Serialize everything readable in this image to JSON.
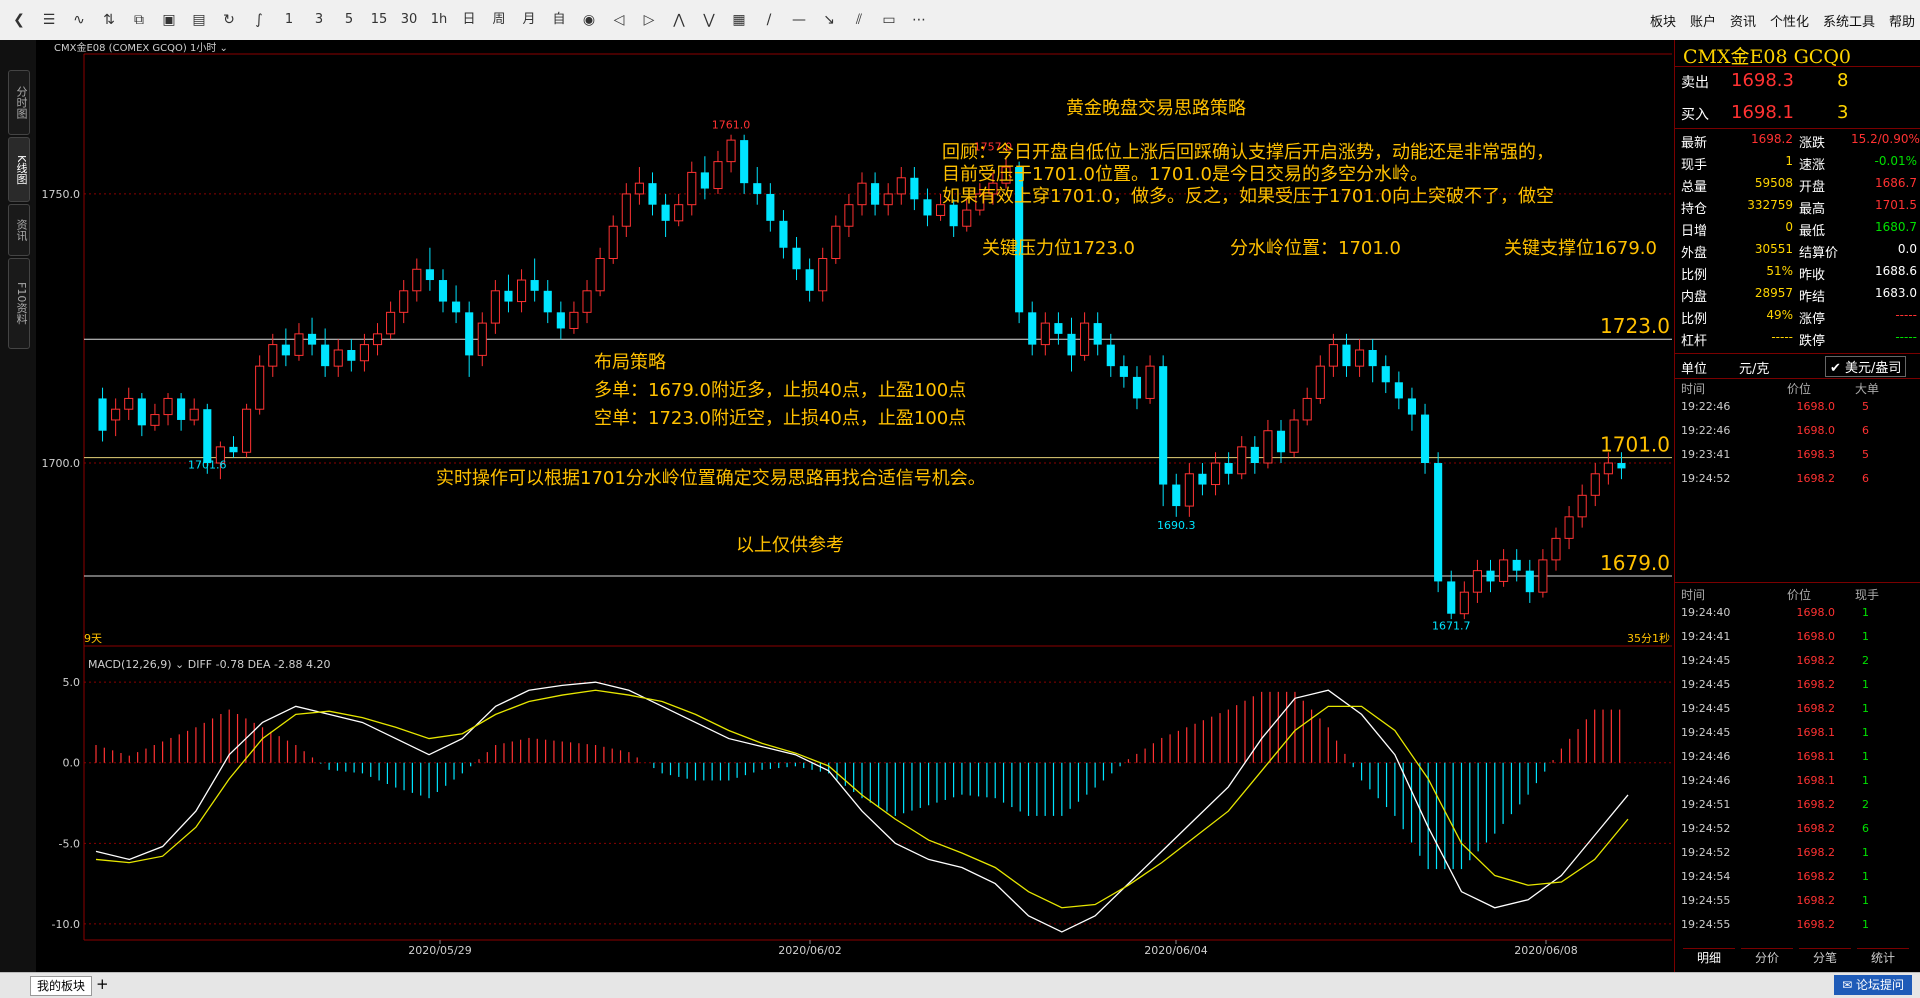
{
  "toolbar": {
    "tools": [
      {
        "icon": "back-icon",
        "g": "❮"
      },
      {
        "icon": "list-icon",
        "g": "☰"
      },
      {
        "icon": "line-icon",
        "g": "∿"
      },
      {
        "icon": "compare-icon",
        "g": "⇅"
      },
      {
        "icon": "stack-icon",
        "g": "⧉"
      },
      {
        "icon": "panel-icon",
        "g": "▣"
      },
      {
        "icon": "save-icon",
        "g": "▤"
      },
      {
        "icon": "refresh-icon",
        "g": "↻"
      },
      {
        "icon": "indicator-icon",
        "g": "∫"
      }
    ],
    "periods": [
      "1",
      "3",
      "5",
      "15",
      "30",
      "1h",
      "日",
      "周",
      "月",
      "自"
    ],
    "tools2": [
      {
        "icon": "eye-icon",
        "g": "◉"
      },
      {
        "icon": "left-icon",
        "g": "◁"
      },
      {
        "icon": "right-icon",
        "g": "▷"
      },
      {
        "icon": "zoom-in-icon",
        "g": "⋀"
      },
      {
        "icon": "zoom-out-icon",
        "g": "⋁"
      },
      {
        "icon": "layout-icon",
        "g": "▦"
      },
      {
        "icon": "trendline-icon",
        "g": "/"
      },
      {
        "icon": "hline-icon",
        "g": "—"
      },
      {
        "icon": "arrow-icon",
        "g": "↘"
      },
      {
        "icon": "parallel-icon",
        "g": "⫽"
      },
      {
        "icon": "rect-icon",
        "g": "▭"
      },
      {
        "icon": "more-icon",
        "g": "⋯"
      }
    ],
    "menu": [
      "板块",
      "账户",
      "资讯",
      "个性化",
      "系统工具",
      "帮助"
    ]
  },
  "side_tabs": [
    "分时图",
    "K线图",
    "资讯",
    "F10资料"
  ],
  "chart_header": {
    "symbol": "CMX金E08 (COMEX GCQO)",
    "period": "1小时"
  },
  "price_axis": [
    "1750.0",
    "1700.0"
  ],
  "macd_axis": [
    "5.0",
    "0.0",
    "-5.0",
    "-10.0"
  ],
  "date_labels": [
    "2020/05/29",
    "2020/06/02",
    "2020/06/04",
    "2020/06/08"
  ],
  "corner_left": "9天",
  "corner_right": "35分1秒",
  "macd_header": {
    "name": "MACD(12,26,9)",
    "diff": "DIFF -0.78",
    "dea": "DEA -2.88",
    "val": "4.20"
  },
  "annotations": {
    "title": "黄金晚盘交易思路策略",
    "review": [
      "回顾：今日开盘自低位上涨后回踩确认支撑后开启涨势，动能还是非常强的，",
      "目前受压于1701.0位置。1701.0是今日交易的多空分水岭。",
      "如果有效上穿1701.0，做多。反之，如果受压于1701.0向上突破不了，做空"
    ],
    "key_resist": "关键压力位1723.0",
    "pivot": "分水岭位置：1701.0",
    "key_support": "关键支撑位1679.0",
    "strategy": [
      "布局策略",
      "多单：1679.0附近多，止损40点，止盈100点",
      "空单：1723.0附近空，止损40点，止盈100点"
    ],
    "realtime": "实时操作可以根据1701分水岭位置确定交易思路再找合适信号机会。",
    "disclaimer": "以上仅供参考"
  },
  "levels": [
    {
      "label": "1723.0",
      "value": 1723.0
    },
    {
      "label": "1701.0",
      "value": 1701.0
    },
    {
      "label": "1679.0",
      "value": 1679.0
    }
  ],
  "extremes": [
    "1761.0",
    "1757.0",
    "1701.6",
    "1690.3",
    "1671.7"
  ],
  "chart_data": {
    "type": "candlestick",
    "ylim": [
      1666,
      1776
    ],
    "candles": [
      [
        1712,
        1706,
        1714,
        1704
      ],
      [
        1708,
        1710,
        1712,
        1705
      ],
      [
        1710,
        1712,
        1714,
        1708
      ],
      [
        1712,
        1707,
        1713,
        1705
      ],
      [
        1707,
        1709,
        1711,
        1706
      ],
      [
        1709,
        1712,
        1713,
        1707
      ],
      [
        1712,
        1708,
        1713,
        1706
      ],
      [
        1708,
        1710,
        1712,
        1707
      ],
      [
        1710,
        1700,
        1711,
        1698
      ],
      [
        1700,
        1703,
        1704,
        1697
      ],
      [
        1703,
        1702,
        1705,
        1701
      ],
      [
        1702,
        1710,
        1711,
        1701
      ],
      [
        1710,
        1718,
        1720,
        1709
      ],
      [
        1718,
        1722,
        1724,
        1716
      ],
      [
        1722,
        1720,
        1725,
        1718
      ],
      [
        1720,
        1724,
        1726,
        1719
      ],
      [
        1724,
        1722,
        1727,
        1720
      ],
      [
        1722,
        1718,
        1725,
        1716
      ],
      [
        1718,
        1721,
        1723,
        1716
      ],
      [
        1721,
        1719,
        1723,
        1717
      ],
      [
        1719,
        1722,
        1724,
        1717
      ],
      [
        1722,
        1724,
        1726,
        1720
      ],
      [
        1724,
        1728,
        1730,
        1723
      ],
      [
        1728,
        1732,
        1734,
        1726
      ],
      [
        1732,
        1736,
        1738,
        1730
      ],
      [
        1736,
        1734,
        1740,
        1732
      ],
      [
        1734,
        1730,
        1736,
        1728
      ],
      [
        1730,
        1728,
        1733,
        1726
      ],
      [
        1728,
        1720,
        1730,
        1716
      ],
      [
        1720,
        1726,
        1728,
        1718
      ],
      [
        1726,
        1732,
        1734,
        1724
      ],
      [
        1732,
        1730,
        1735,
        1728
      ],
      [
        1730,
        1734,
        1736,
        1728
      ],
      [
        1734,
        1732,
        1738,
        1730
      ],
      [
        1732,
        1728,
        1734,
        1726
      ],
      [
        1728,
        1725,
        1730,
        1723
      ],
      [
        1725,
        1728,
        1730,
        1724
      ],
      [
        1728,
        1732,
        1734,
        1726
      ],
      [
        1732,
        1738,
        1740,
        1731
      ],
      [
        1738,
        1744,
        1746,
        1737
      ],
      [
        1744,
        1750,
        1752,
        1742
      ],
      [
        1750,
        1752,
        1755,
        1748
      ],
      [
        1752,
        1748,
        1754,
        1746
      ],
      [
        1748,
        1745,
        1750,
        1742
      ],
      [
        1745,
        1748,
        1750,
        1744
      ],
      [
        1748,
        1754,
        1756,
        1746
      ],
      [
        1754,
        1751,
        1757,
        1749
      ],
      [
        1751,
        1756,
        1758,
        1750
      ],
      [
        1756,
        1760,
        1761,
        1754
      ],
      [
        1760,
        1752,
        1761,
        1750
      ],
      [
        1752,
        1750,
        1755,
        1748
      ],
      [
        1750,
        1745,
        1752,
        1743
      ],
      [
        1745,
        1740,
        1747,
        1738
      ],
      [
        1740,
        1736,
        1742,
        1734
      ],
      [
        1736,
        1732,
        1738,
        1730
      ],
      [
        1732,
        1738,
        1740,
        1730
      ],
      [
        1738,
        1744,
        1746,
        1737
      ],
      [
        1744,
        1748,
        1750,
        1742
      ],
      [
        1748,
        1752,
        1754,
        1746
      ],
      [
        1752,
        1748,
        1754,
        1746
      ],
      [
        1748,
        1750,
        1752,
        1746
      ],
      [
        1750,
        1753,
        1755,
        1748
      ],
      [
        1753,
        1749,
        1755,
        1747
      ],
      [
        1749,
        1746,
        1751,
        1744
      ],
      [
        1746,
        1748,
        1750,
        1745
      ],
      [
        1748,
        1744,
        1749,
        1742
      ],
      [
        1744,
        1747,
        1749,
        1743
      ],
      [
        1747,
        1750,
        1752,
        1746
      ],
      [
        1750,
        1752,
        1754,
        1748
      ],
      [
        1752,
        1755,
        1757,
        1751
      ],
      [
        1755,
        1728,
        1756,
        1726
      ],
      [
        1728,
        1722,
        1730,
        1720
      ],
      [
        1722,
        1726,
        1728,
        1720
      ],
      [
        1726,
        1724,
        1728,
        1722
      ],
      [
        1724,
        1720,
        1727,
        1717
      ],
      [
        1720,
        1726,
        1728,
        1719
      ],
      [
        1726,
        1722,
        1728,
        1720
      ],
      [
        1722,
        1718,
        1724,
        1716
      ],
      [
        1718,
        1716,
        1720,
        1714
      ],
      [
        1716,
        1712,
        1718,
        1710
      ],
      [
        1712,
        1718,
        1720,
        1711
      ],
      [
        1718,
        1696,
        1720,
        1692
      ],
      [
        1696,
        1692,
        1698,
        1690
      ],
      [
        1692,
        1698,
        1700,
        1690
      ],
      [
        1698,
        1696,
        1700,
        1694
      ],
      [
        1696,
        1700,
        1702,
        1694
      ],
      [
        1700,
        1698,
        1702,
        1696
      ],
      [
        1698,
        1703,
        1705,
        1697
      ],
      [
        1703,
        1700,
        1705,
        1698
      ],
      [
        1700,
        1706,
        1708,
        1699
      ],
      [
        1706,
        1702,
        1708,
        1700
      ],
      [
        1702,
        1708,
        1710,
        1701
      ],
      [
        1708,
        1712,
        1714,
        1707
      ],
      [
        1712,
        1718,
        1720,
        1711
      ],
      [
        1718,
        1722,
        1724,
        1716
      ],
      [
        1722,
        1718,
        1724,
        1716
      ],
      [
        1718,
        1721,
        1723,
        1716
      ],
      [
        1721,
        1718,
        1723,
        1715
      ],
      [
        1718,
        1715,
        1720,
        1713
      ],
      [
        1715,
        1712,
        1717,
        1710
      ],
      [
        1712,
        1709,
        1714,
        1706
      ],
      [
        1709,
        1700,
        1711,
        1698
      ],
      [
        1700,
        1678,
        1702,
        1676
      ],
      [
        1678,
        1672,
        1680,
        1671
      ],
      [
        1672,
        1676,
        1678,
        1671
      ],
      [
        1676,
        1680,
        1682,
        1674
      ],
      [
        1680,
        1678,
        1682,
        1676
      ],
      [
        1678,
        1682,
        1684,
        1677
      ],
      [
        1682,
        1680,
        1684,
        1678
      ],
      [
        1680,
        1676,
        1682,
        1674
      ],
      [
        1676,
        1682,
        1684,
        1675
      ],
      [
        1682,
        1686,
        1688,
        1680
      ],
      [
        1686,
        1690,
        1692,
        1684
      ],
      [
        1690,
        1694,
        1696,
        1688
      ],
      [
        1694,
        1698,
        1700,
        1692
      ],
      [
        1698,
        1700,
        1702,
        1696
      ],
      [
        1700,
        1699,
        1702,
        1697
      ]
    ],
    "macd": {
      "diff": [
        -5.5,
        -6.0,
        -5.2,
        -3.0,
        0.5,
        2.5,
        3.5,
        3.0,
        2.5,
        1.5,
        0.5,
        1.5,
        3.5,
        4.5,
        4.8,
        5.0,
        4.5,
        3.5,
        2.5,
        1.5,
        1.0,
        0.5,
        -0.5,
        -3.0,
        -5.0,
        -6.0,
        -6.5,
        -7.5,
        -9.5,
        -10.5,
        -9.5,
        -7.5,
        -5.5,
        -3.5,
        -1.5,
        1.5,
        4.0,
        4.5,
        3.0,
        0.5,
        -4.0,
        -8.0,
        -9.0,
        -8.5,
        -7.0,
        -4.5,
        -2.0
      ],
      "dea": [
        -6.0,
        -6.2,
        -5.8,
        -4.0,
        -1.0,
        1.5,
        3.0,
        3.2,
        2.8,
        2.2,
        1.5,
        1.8,
        3.0,
        3.8,
        4.2,
        4.5,
        4.2,
        3.8,
        3.0,
        2.0,
        1.2,
        0.6,
        -0.2,
        -2.0,
        -3.5,
        -4.8,
        -5.6,
        -6.5,
        -8.0,
        -9.0,
        -8.8,
        -7.6,
        -6.2,
        -4.6,
        -3.0,
        -0.5,
        2.0,
        3.5,
        3.5,
        2.0,
        -1.0,
        -5.0,
        -7.0,
        -7.6,
        -7.4,
        -6.0,
        -3.5
      ]
    }
  },
  "rp": {
    "title": "CMX金E08  GCQ0",
    "ask": {
      "label": "卖出",
      "price": "1698.3",
      "vol": "8"
    },
    "bid": {
      "label": "买入",
      "price": "1698.1",
      "vol": "3"
    },
    "stats": [
      [
        "最新",
        "1698.2",
        "涨跌",
        "15.2/0.90%"
      ],
      [
        "现手",
        "1",
        "速涨",
        "-0.01%"
      ],
      [
        "总量",
        "59508",
        "开盘",
        "1686.7"
      ],
      [
        "持仓",
        "332759",
        "最高",
        "1701.5"
      ],
      [
        "日增",
        "0",
        "最低",
        "1680.7"
      ],
      [
        "外盘",
        "30551",
        "结算价",
        "0.0"
      ],
      [
        "比例",
        "51%",
        "昨收",
        "1688.6"
      ],
      [
        "内盘",
        "28957",
        "昨结",
        "1683.0"
      ],
      [
        "比例",
        "49%",
        "涨停",
        "-----"
      ],
      [
        "杠杆",
        "-----",
        "跌停",
        "-----"
      ]
    ],
    "unit": {
      "label": "单位",
      "v1": "元/克",
      "v2": "美元/盎司"
    },
    "big": {
      "headers": [
        "时间",
        "价位",
        "大单"
      ],
      "rows": [
        [
          "19:22:46",
          "1698.0",
          "5"
        ],
        [
          "19:22:46",
          "1698.0",
          "6"
        ],
        [
          "19:23:41",
          "1698.3",
          "5"
        ],
        [
          "19:24:52",
          "1698.2",
          "6"
        ]
      ]
    },
    "ticks": {
      "headers": [
        "时间",
        "价位",
        "现手"
      ],
      "rows": [
        [
          "19:24:40",
          "1698.0",
          "1"
        ],
        [
          "19:24:41",
          "1698.0",
          "1"
        ],
        [
          "19:24:45",
          "1698.2",
          "2"
        ],
        [
          "19:24:45",
          "1698.2",
          "1"
        ],
        [
          "19:24:45",
          "1698.2",
          "1"
        ],
        [
          "19:24:45",
          "1698.1",
          "1"
        ],
        [
          "19:24:46",
          "1698.1",
          "1"
        ],
        [
          "19:24:46",
          "1698.1",
          "1"
        ],
        [
          "19:24:51",
          "1698.2",
          "2"
        ],
        [
          "19:24:52",
          "1698.2",
          "6"
        ],
        [
          "19:24:52",
          "1698.2",
          "1"
        ],
        [
          "19:24:54",
          "1698.2",
          "1"
        ],
        [
          "19:24:55",
          "1698.2",
          "1"
        ],
        [
          "19:24:55",
          "1698.2",
          "1"
        ]
      ]
    },
    "tabs": [
      "明细",
      "分价",
      "分笔",
      "统计"
    ]
  },
  "bottom": {
    "tab": "我的板块",
    "plus": "+",
    "forum": "论坛提问"
  },
  "colors": {
    "up": "#ff3232",
    "down": "#00e5ff",
    "yellow": "#ffc000",
    "grid": "#8b0000"
  }
}
